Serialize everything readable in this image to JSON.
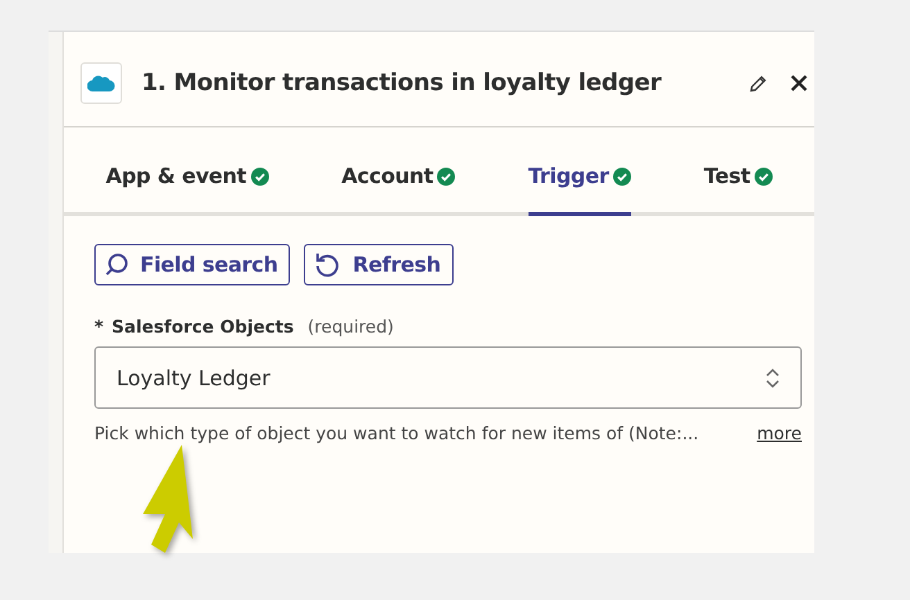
{
  "panel": {
    "title": "1. Monitor transactions in loyalty ledger"
  },
  "tabs": [
    {
      "label": "App & event",
      "selected": false,
      "done": true
    },
    {
      "label": "Account",
      "selected": false,
      "done": true
    },
    {
      "label": "Trigger",
      "selected": true,
      "done": true
    },
    {
      "label": "Test",
      "selected": false,
      "done": true
    }
  ],
  "buttons": [
    {
      "kind": "search",
      "label": "Field search"
    },
    {
      "kind": "refresh",
      "label": "Refresh"
    }
  ],
  "field": {
    "required_mark": "*",
    "label": "Salesforce Objects",
    "note": "(required)",
    "value": "Loyalty Ledger",
    "help": "Pick which type of object you want to watch for new items of (Note:...",
    "more": "more"
  }
}
